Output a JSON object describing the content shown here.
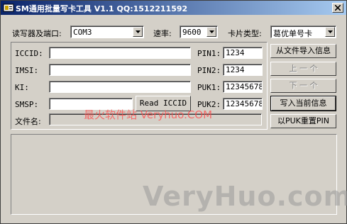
{
  "window": {
    "title": "SM通用批量写卡工具 V1.1  QQ:1512211592"
  },
  "reader": {
    "label": "读写器及端口:",
    "port_value": "COM3"
  },
  "rate": {
    "label": "速率:",
    "value": "9600"
  },
  "card_type": {
    "label": "卡片类型:",
    "value": "葛优单号卡"
  },
  "fields": {
    "iccid": {
      "label": "ICCID:",
      "value": ""
    },
    "imsi": {
      "label": "IMSI:",
      "value": ""
    },
    "ki": {
      "label": "KI:",
      "value": ""
    },
    "smsp": {
      "label": "SMSP:",
      "value": ""
    },
    "filename": {
      "label": "文件名:",
      "value": ""
    }
  },
  "pins": {
    "pin1": {
      "label": "PIN1:",
      "value": "1234"
    },
    "pin2": {
      "label": "PIN2:",
      "value": "1234"
    },
    "puk1": {
      "label": "PUK1:",
      "value": "12345678"
    },
    "puk2": {
      "label": "PUK2:",
      "value": "12345678"
    }
  },
  "buttons": {
    "read_iccid": "Read ICCID",
    "import_file": "从文件导入信息",
    "prev": "上 一 个",
    "next": "下 一 个",
    "write_current": "写入当前信息",
    "reset_pin": "以PUK重置PIN"
  },
  "watermarks": {
    "red": "最火软件站 Veryhuo.COM",
    "gray": "VeryHuo.com"
  },
  "icons": [
    "app-icon",
    "close-icon",
    "dropdown-arrow-icon"
  ]
}
